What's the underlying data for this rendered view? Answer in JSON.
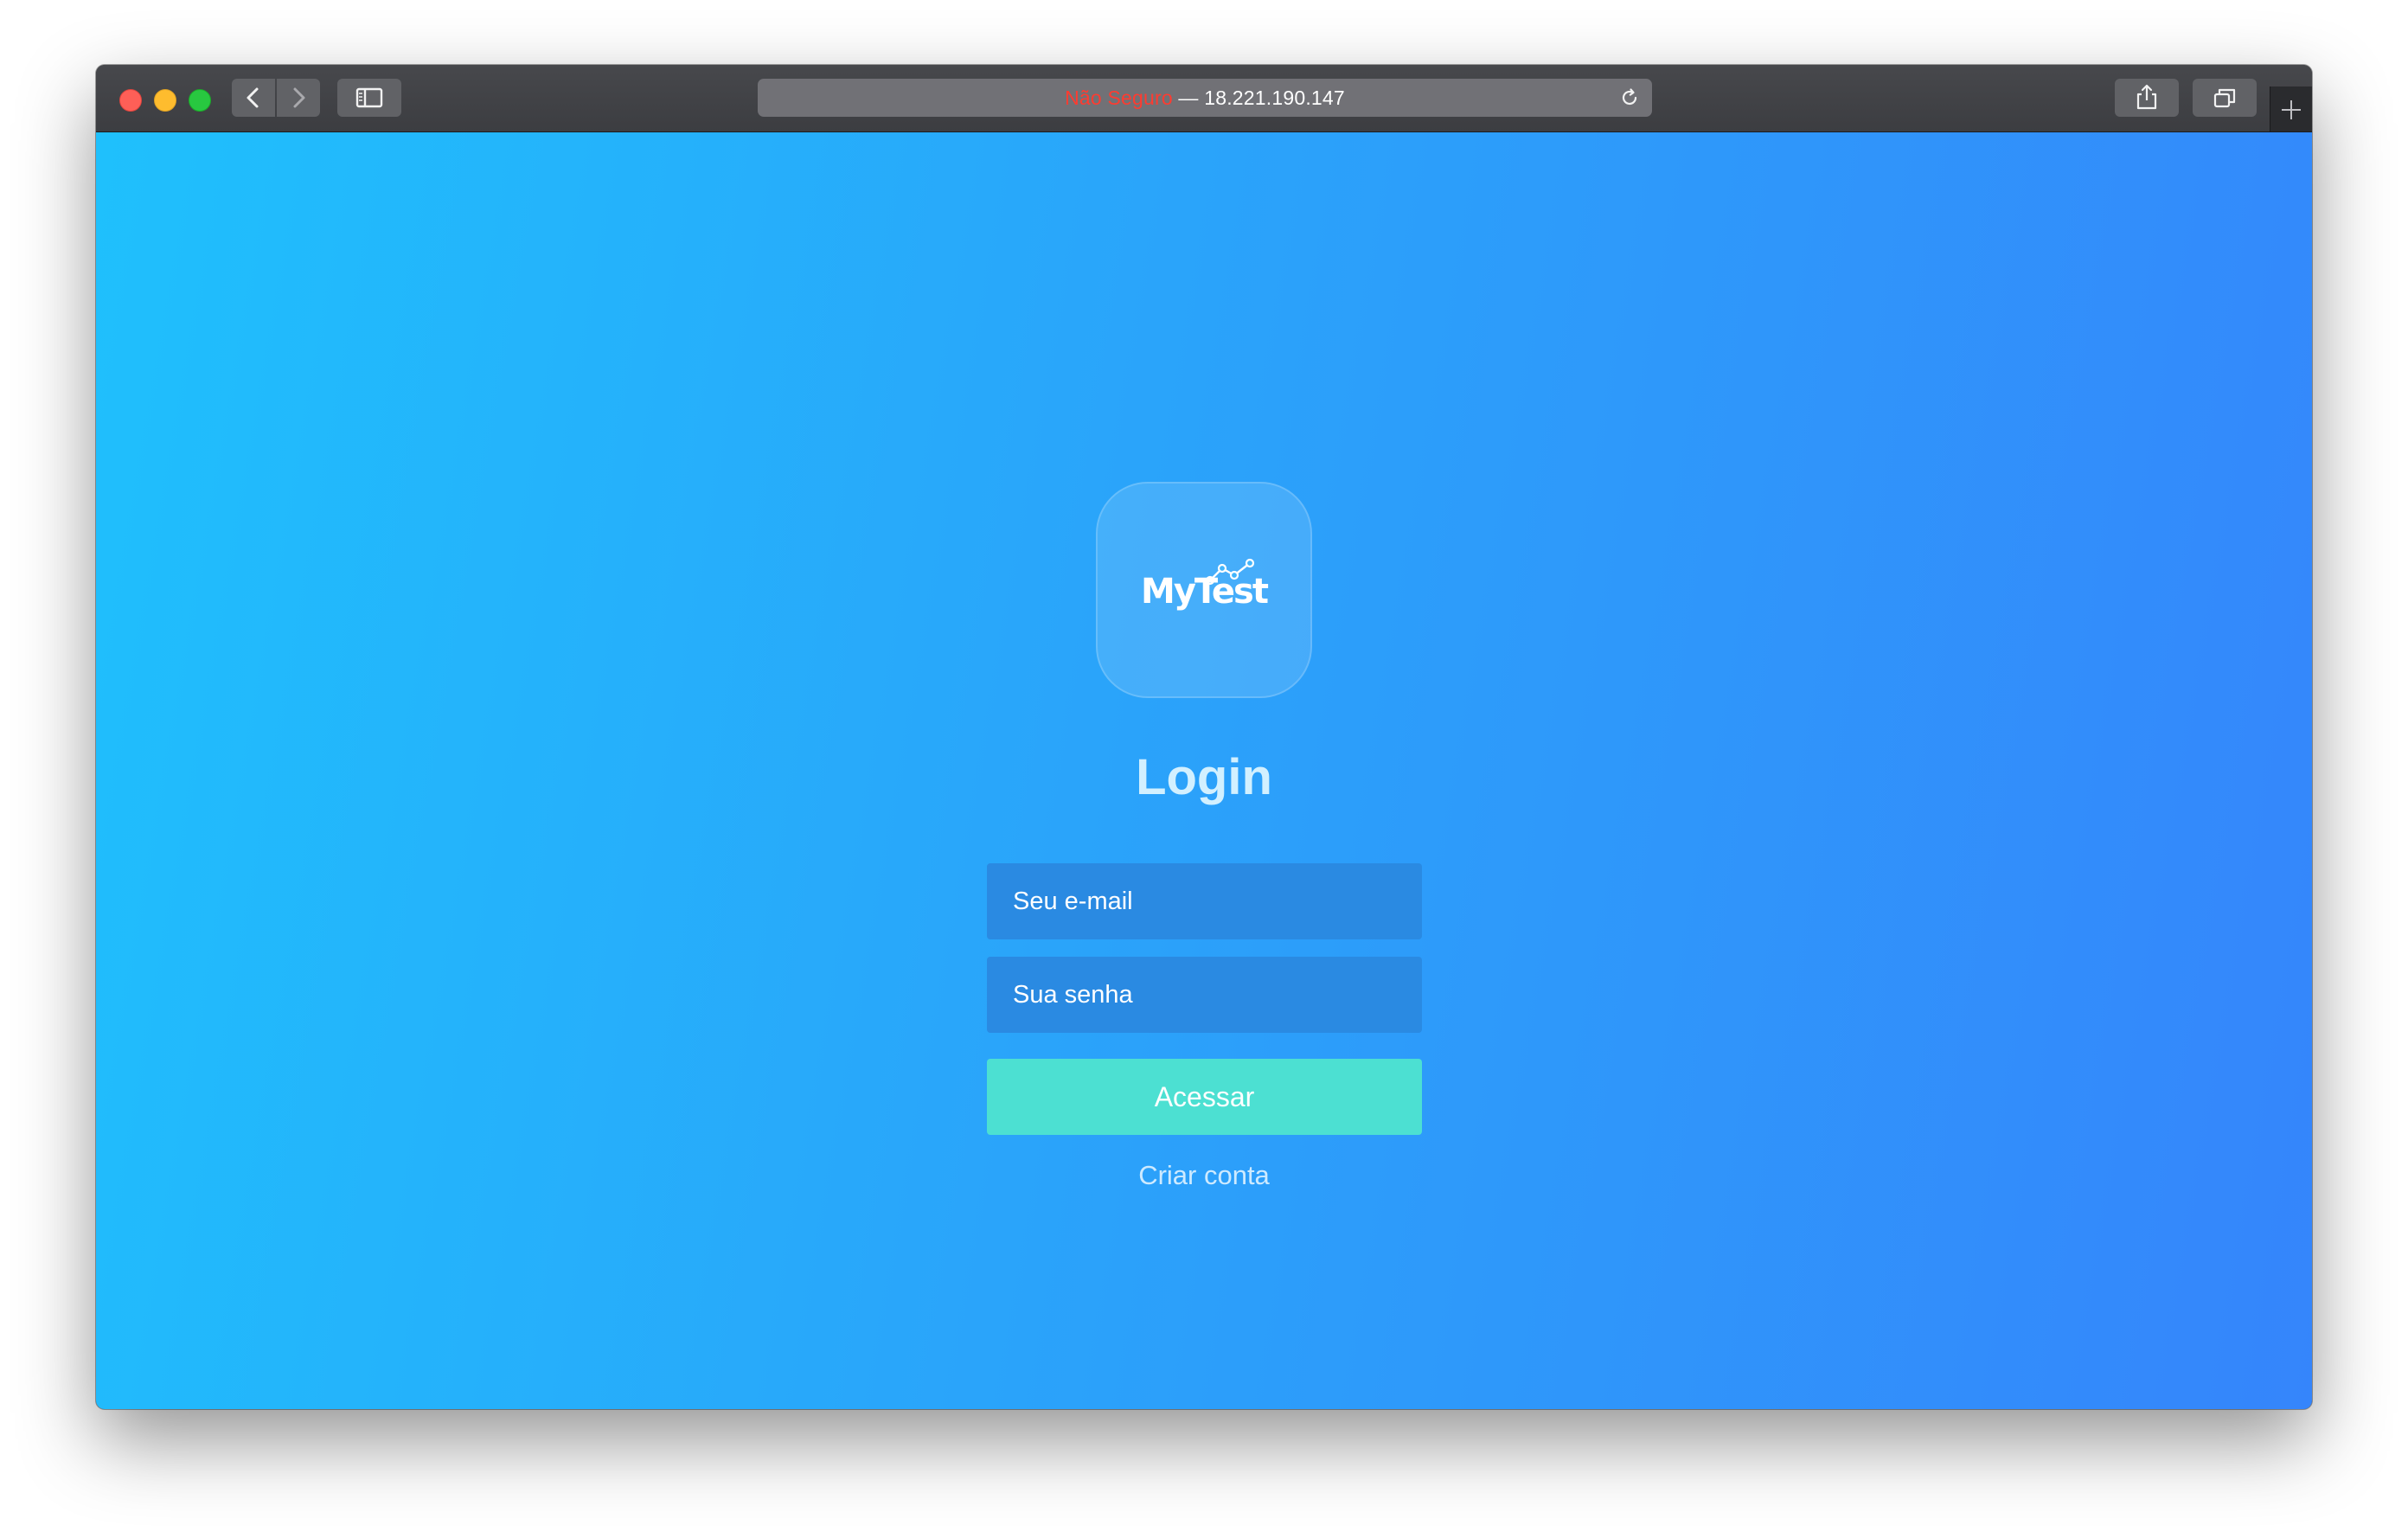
{
  "browser": {
    "url_insecure_label": "Não Seguro",
    "url_separator": " — ",
    "url_host": "18.221.190.147",
    "icons": {
      "back": "chevron-left-icon",
      "forward": "chevron-right-icon",
      "sidebar": "sidebar-icon",
      "reload": "reload-icon",
      "share": "share-icon",
      "tabs": "tabs-overview-icon",
      "new_tab": "plus-icon"
    }
  },
  "page": {
    "logo_text": "MyTest",
    "title": "Login",
    "email_placeholder": "Seu e-mail",
    "password_placeholder": "Sua senha",
    "submit_label": "Acessar",
    "create_account_label": "Criar conta"
  },
  "colors": {
    "gradient_start": "#1fc0fc",
    "gradient_end": "#3585fb",
    "button": "#4ce0d2",
    "insecure": "#ff3b30"
  }
}
